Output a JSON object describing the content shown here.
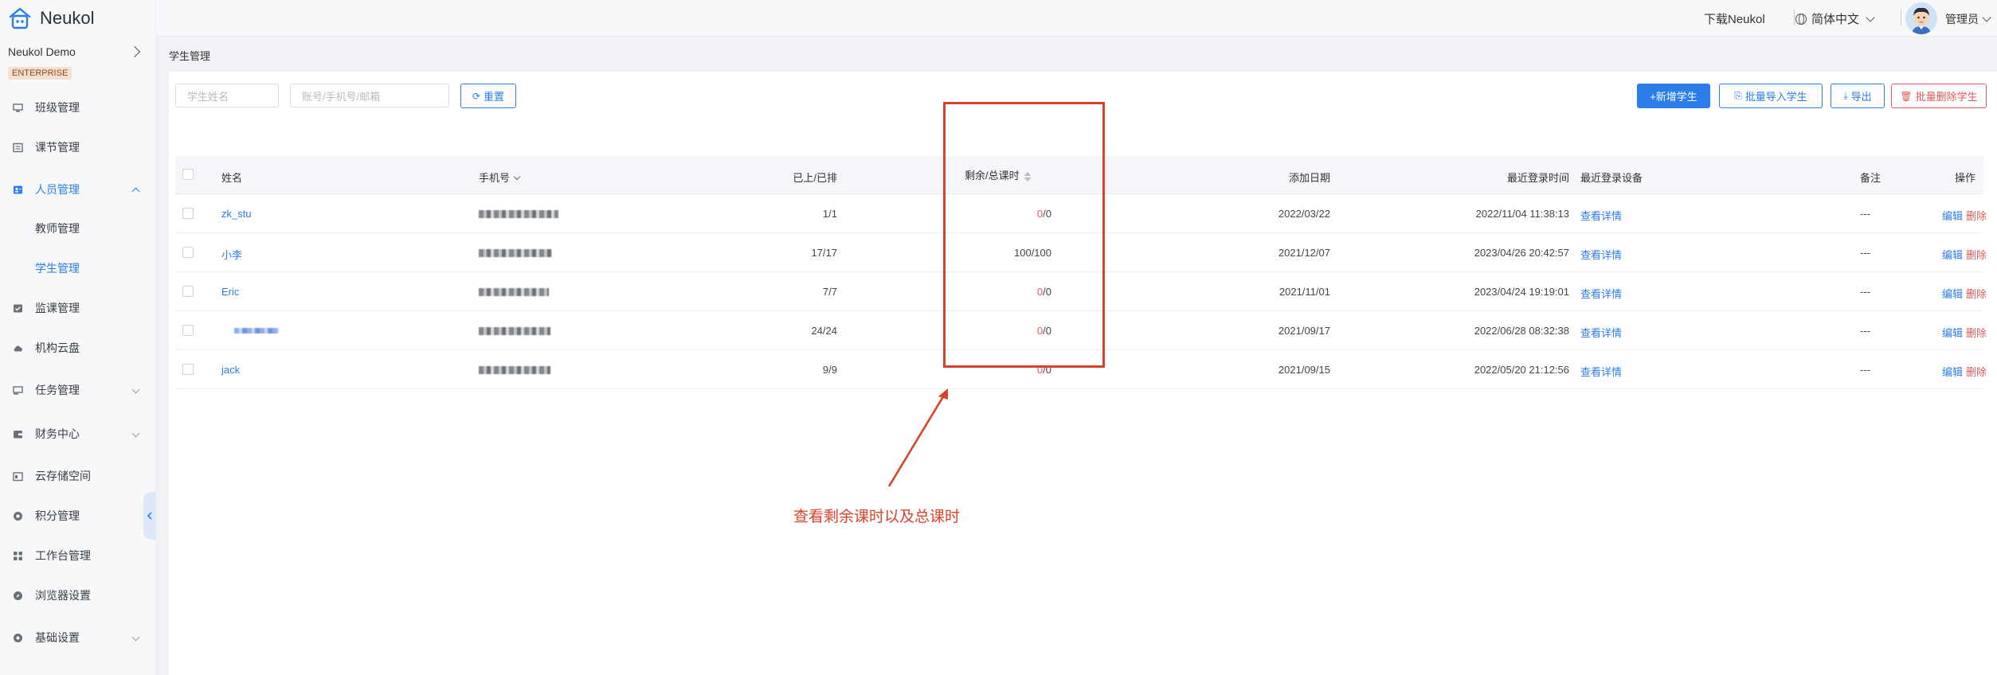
{
  "app": {
    "name": "Neukol"
  },
  "sidebar": {
    "org_name": "Neukol Demo",
    "edition_badge": "ENTERPRISE",
    "items": [
      {
        "label": "班级管理",
        "icon": "monitor-icon"
      },
      {
        "label": "课节管理",
        "icon": "list-icon"
      },
      {
        "label": "人员管理",
        "icon": "people-icon"
      },
      {
        "label": "教师管理",
        "icon": ""
      },
      {
        "label": "学生管理",
        "icon": ""
      },
      {
        "label": "监课管理",
        "icon": "monitor-check-icon"
      },
      {
        "label": "机构云盘",
        "icon": "cloud-icon"
      },
      {
        "label": "任务管理",
        "icon": "task-icon"
      },
      {
        "label": "财务中心",
        "icon": "wallet-icon"
      },
      {
        "label": "云存储空间",
        "icon": "storage-icon"
      },
      {
        "label": "积分管理",
        "icon": "points-icon"
      },
      {
        "label": "工作台管理",
        "icon": "grid-icon"
      },
      {
        "label": "浏览器设置",
        "icon": "compass-icon"
      },
      {
        "label": "基础设置",
        "icon": "settings-icon"
      }
    ]
  },
  "topbar": {
    "download": "下载Neukol",
    "language": "简体中文",
    "user": "管理员"
  },
  "breadcrumb": "学生管理",
  "filters": {
    "name_placeholder": "学生姓名",
    "account_placeholder": "账号/手机号/邮箱",
    "reset": "重置"
  },
  "actions": {
    "add": "+新增学生",
    "batch_import": "批量导入学生",
    "export": "导出",
    "batch_delete": "批量删除学生"
  },
  "table": {
    "headers": {
      "name": "姓名",
      "phone": "手机号",
      "attended": "已上/已排",
      "remaining": "剩余/总课时",
      "added_date": "添加日期",
      "last_login": "最近登录时间",
      "last_device": "最近登录设备",
      "remark": "备注",
      "ops": "操作"
    },
    "rows": [
      {
        "name": "zk_stu",
        "attended": "1/1",
        "remaining": "0",
        "total": "/0",
        "added": "2022/03/22",
        "last_login": "2022/11/04 11:38:13",
        "device": "查看详情",
        "remark": "---",
        "edit": "编辑",
        "delete": "删除"
      },
      {
        "name": "小李",
        "attended": "17/17",
        "remaining": "100",
        "total": "/100",
        "added": "2021/12/07",
        "last_login": "2023/04/26 20:42:57",
        "device": "查看详情",
        "remark": "---",
        "edit": "编辑",
        "delete": "删除"
      },
      {
        "name": "Eric",
        "attended": "7/7",
        "remaining": "0",
        "total": "/0",
        "added": "2021/11/01",
        "last_login": "2023/04/24 19:19:01",
        "device": "查看详情",
        "remark": "---",
        "edit": "编辑",
        "delete": "删除"
      },
      {
        "name": "",
        "attended": "24/24",
        "remaining": "0",
        "total": "/0",
        "added": "2021/09/17",
        "last_login": "2022/06/28 08:32:38",
        "device": "查看详情",
        "remark": "---",
        "edit": "编辑",
        "delete": "删除"
      },
      {
        "name": "jack",
        "attended": "9/9",
        "remaining": "0",
        "total": "/0",
        "added": "2021/09/15",
        "last_login": "2022/05/20 21:12:56",
        "device": "查看详情",
        "remark": "---",
        "edit": "编辑",
        "delete": "删除"
      }
    ]
  },
  "annotation": {
    "text": "查看剩余课时以及总课时",
    "color": "#d9422b"
  },
  "colors": {
    "accent": "#2b7de9",
    "danger": "#e05b5b"
  }
}
